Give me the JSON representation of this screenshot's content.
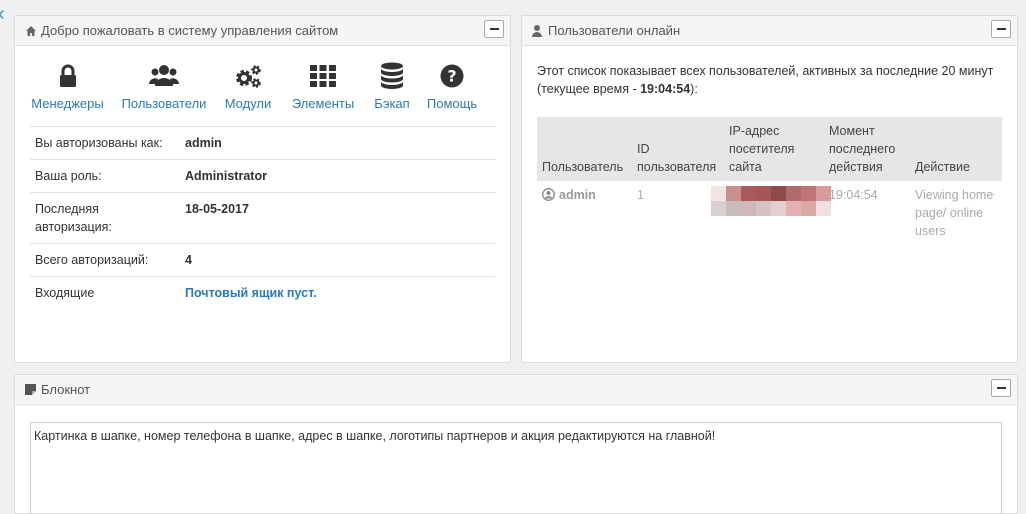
{
  "welcome": {
    "title": "Добро пожаловать в систему управления сайтом",
    "shortcuts": [
      {
        "label": "Менеджеры",
        "icon": "lock-icon"
      },
      {
        "label": "Пользователи",
        "icon": "users-icon"
      },
      {
        "label": "Модули",
        "icon": "cogs-icon"
      },
      {
        "label": "Элементы",
        "icon": "grid-icon"
      },
      {
        "label": "Бэкап",
        "icon": "database-icon"
      },
      {
        "label": "Помощь",
        "icon": "question-icon"
      }
    ],
    "info": [
      {
        "key": "Вы авторизованы как:",
        "value": "admin"
      },
      {
        "key": "Ваша роль:",
        "value": "Administrator"
      },
      {
        "key": "Последняя авторизация:",
        "value": "18-05-2017"
      },
      {
        "key": "Всего авторизаций:",
        "value": "4"
      },
      {
        "key": "Входящие",
        "value": "Почтовый ящик пуст."
      }
    ]
  },
  "online": {
    "title": "Пользователи онлайн",
    "desc_prefix": "Этот список показывает всех пользователей, активных за последние 20 минут (текущее время - ",
    "current_time": "19:04:54",
    "desc_suffix": "):",
    "columns": [
      "Пользователь",
      "ID пользователя",
      "IP-адрес посетителя сайта",
      "Момент последнего действия",
      "Действие"
    ],
    "rows": [
      {
        "user": "admin",
        "id": "1",
        "ip": "",
        "time": "19:04:54",
        "action": "Viewing home page/ online users"
      }
    ]
  },
  "notepad": {
    "title": "Блокнот",
    "text": "Картинка в шапке, номер телефона в шапке, адрес в шапке, логотипы партнеров и акция редактируются на главной!"
  },
  "colors": {
    "accent": "#2a7ab8",
    "panel_header": "#f5f5f5",
    "table_header": "#e6e6e6"
  }
}
